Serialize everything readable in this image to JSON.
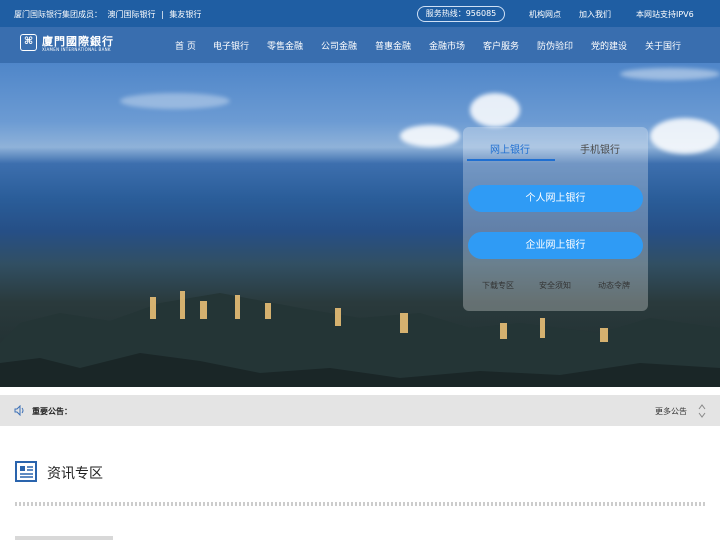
{
  "topbar": {
    "group_label": "厦门国际银行集团成员：",
    "member1": "澳门国际银行",
    "sep": "|",
    "member2": "集友银行",
    "hotline": "服务热线：956085",
    "links": [
      "机构网点",
      "加入我们",
      "本网站支持IPV6"
    ]
  },
  "logo": {
    "cn": "廈門國際銀行",
    "en": "XIAMEN INTERNATIONAL BANK"
  },
  "nav": {
    "items": [
      "首 页",
      "电子银行",
      "零售金融",
      "公司金融",
      "普惠金融",
      "金融市场",
      "客户服务",
      "防伪验印",
      "党的建设",
      "关于国行"
    ]
  },
  "login": {
    "tabs": [
      "网上银行",
      "手机银行"
    ],
    "personal_button": "个人网上银行",
    "corporate_button": "企业网上银行",
    "sublinks": [
      "下载专区",
      "安全须知",
      "动态令牌"
    ]
  },
  "notice": {
    "label": "重要公告：",
    "more": "更多公告"
  },
  "news": {
    "title": "资讯专区"
  },
  "colors": {
    "topbar": "#1f5ea3",
    "nav": "#2862a8",
    "accent_button": "#2f9bf5",
    "active_tab": "#1f6fd1"
  },
  "icons": [
    "speaker-icon",
    "news-icon",
    "up-down-arrows-icon"
  ]
}
